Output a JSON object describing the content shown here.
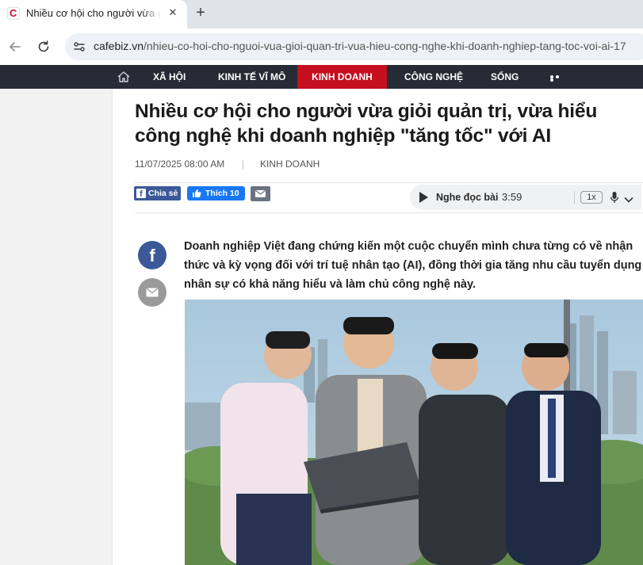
{
  "browser": {
    "tab_title": "Nhiều cơ hội cho người vừa giỏi quản trị, vừa hiểu công nghệ khi doanh nghiệp tăng tốc với AI",
    "favicon_letter": "C",
    "url_domain": "cafebiz.vn",
    "url_path": "/nhieu-co-hoi-cho-nguoi-vua-gioi-quan-tri-vua-hieu-cong-nghe-khi-doanh-nghiep-tang-toc-voi-ai-17"
  },
  "sitenav": {
    "items": [
      {
        "label": "Xã hội"
      },
      {
        "label": "Kinh tế vĩ mô"
      },
      {
        "label": "Kinh doanh"
      },
      {
        "label": "Công nghệ"
      },
      {
        "label": "Sống"
      }
    ],
    "active_index": 2,
    "active_color": "#c50f1f",
    "background": "#262b36"
  },
  "article": {
    "title": "Nhiều cơ hội cho người vừa giỏi quản trị, vừa hiểu công nghệ khi doanh nghiệp \"tăng tốc\" với AI",
    "date": "11/07/2025 08:00 AM",
    "category": "Kinh doanh",
    "lead": "Doanh nghiệp Việt đang chứng kiến một cuộc chuyển mình chưa từng có về nhận thức và kỳ vọng đối với trí tuệ nhân tạo (AI), đồng thời gia tăng nhu cầu tuyển dụng nhân sự có khả năng hiểu và làm chủ công nghệ này."
  },
  "share": {
    "share_label": "Chia sẻ",
    "like_label": "Thích 10"
  },
  "audio": {
    "label": "Nghe đọc bài",
    "duration": "3:59",
    "speed": "1x"
  },
  "icons": [
    "home-icon",
    "more-icon",
    "facebook-icon",
    "mail-icon",
    "play-icon",
    "mic-icon",
    "chevron-down-icon",
    "back-icon",
    "reload-icon",
    "site-info-icon",
    "close-icon",
    "new-tab-icon"
  ]
}
